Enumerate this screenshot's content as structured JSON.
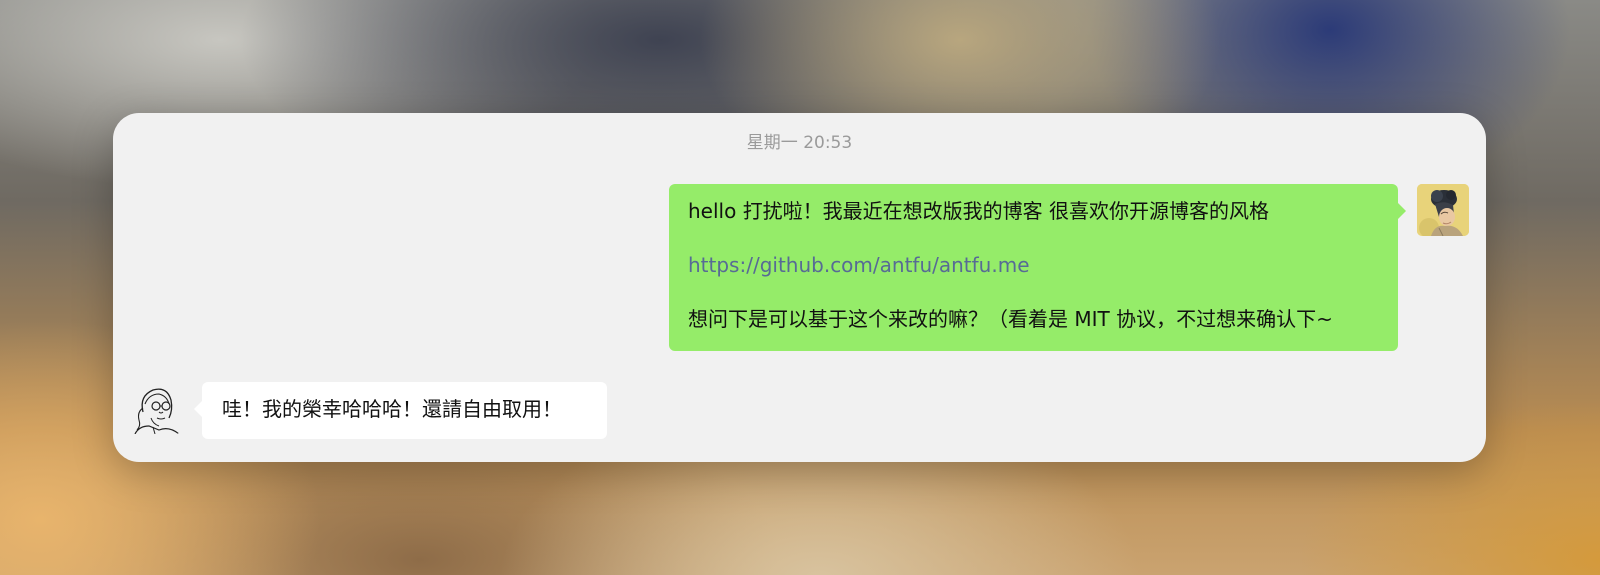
{
  "chat": {
    "timestamp": "星期一 20:53",
    "messages": [
      {
        "direction": "sent",
        "line1": "hello 打扰啦！我最近在想改版我的博客 很喜欢你开源博客的风格",
        "link": "https://github.com/antfu/antfu.me",
        "line3": "想问下是可以基于这个来改的嘛？（看着是 MIT 协议，不过想来确认下~"
      },
      {
        "direction": "received",
        "text": "哇！我的榮幸哈哈哈！還請自由取用！"
      }
    ]
  },
  "colors": {
    "sent_bubble": "#95ec69",
    "received_bubble": "#ffffff",
    "window_bg": "#f1f1f1",
    "link": "#576b95",
    "timestamp": "#9a9a9a"
  },
  "icons": {
    "sender_avatar": "user-photo-avatar-icon",
    "recipient_avatar": "line-drawing-avatar-icon"
  }
}
